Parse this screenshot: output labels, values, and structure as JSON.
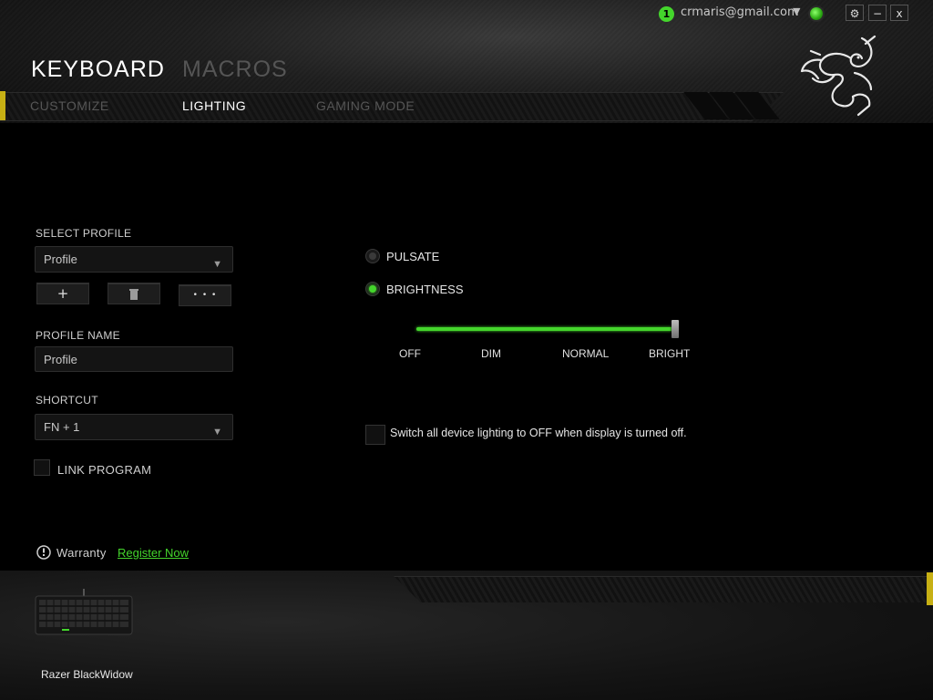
{
  "header": {
    "user_badge": "1",
    "user_email": "crmaris@gmail.com",
    "caret": "▼",
    "window_buttons": {
      "settings": "⚙",
      "minimize": "−",
      "close": "x"
    },
    "main_tabs": [
      {
        "label": "KEYBOARD",
        "active": true
      },
      {
        "label": "MACROS",
        "active": false
      }
    ],
    "sub_tabs": [
      {
        "label": "CUSTOMIZE",
        "active": false
      },
      {
        "label": "LIGHTING",
        "active": true
      },
      {
        "label": "GAMING MODE",
        "active": false
      }
    ],
    "logo_icon": "razer-snake-icon"
  },
  "profile": {
    "select_label": "SELECT PROFILE",
    "selected": "Profile",
    "add_label": "+",
    "delete_icon": "trash-icon",
    "more_label": "• • •",
    "name_label": "PROFILE NAME",
    "name_value": "Profile",
    "shortcut_label": "SHORTCUT",
    "shortcut_value": "FN + 1",
    "link_program_label": "LINK PROGRAM",
    "link_program_checked": false
  },
  "lighting": {
    "pulsate_label": "PULSATE",
    "pulsate_selected": false,
    "brightness_label": "BRIGHTNESS",
    "brightness_selected": true,
    "brightness_level": 1.0,
    "levels": [
      "OFF",
      "DIM",
      "NORMAL",
      "BRIGHT"
    ],
    "display_off_label": "Switch all device lighting to OFF when display is turned off.",
    "display_off_checked": false
  },
  "warranty": {
    "label": "Warranty",
    "link": "Register Now"
  },
  "device": {
    "name": "Razer BlackWidow"
  },
  "colors": {
    "accent_green": "#44d62c",
    "accent_yellow": "#c7b014"
  }
}
